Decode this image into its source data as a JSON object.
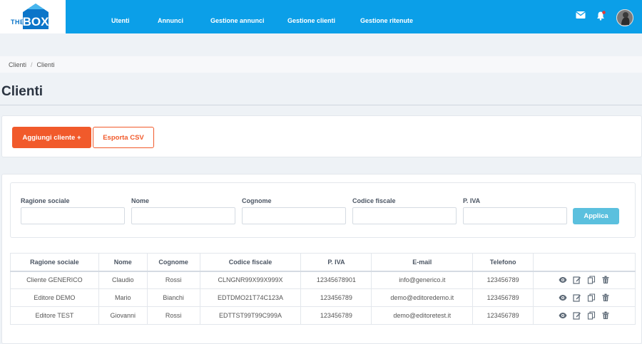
{
  "brand": {
    "the": "THE",
    "box": "BOX"
  },
  "nav": {
    "items": [
      {
        "label": "Utenti"
      },
      {
        "label": "Annunci"
      },
      {
        "label": "Gestione annunci"
      },
      {
        "label": "Gestione clienti"
      },
      {
        "label": "Gestione ritenute"
      }
    ]
  },
  "breadcrumb": [
    "Clienti",
    "Clienti"
  ],
  "page_title": "Clienti",
  "actions": {
    "add_label": "Aggiungi cliente +",
    "export_label": "Esporta CSV"
  },
  "filters": {
    "fields": [
      {
        "label": "Ragione sociale",
        "value": ""
      },
      {
        "label": "Nome",
        "value": ""
      },
      {
        "label": "Cognome",
        "value": ""
      },
      {
        "label": "Codice fiscale",
        "value": ""
      },
      {
        "label": "P. IVA",
        "value": ""
      }
    ],
    "apply_label": "Applica"
  },
  "table": {
    "headers": [
      "Ragione sociale",
      "Nome",
      "Cognome",
      "Codice fiscale",
      "P. IVA",
      "E-mail",
      "Telefono",
      ""
    ],
    "rows": [
      [
        "Cliente GENERICO",
        "Claudio",
        "Rossi",
        "CLNGNR99X99X999X",
        "12345678901",
        "info@generico.it",
        "123456789"
      ],
      [
        "Editore DEMO",
        "Mario",
        "Bianchi",
        "EDTDMO21T74C123A",
        "123456789",
        "demo@editoredemo.it",
        "123456789"
      ],
      [
        "Editore TEST",
        "Giovanni",
        "Rossi",
        "EDTTST99T99C999A",
        "123456789",
        "demo@editoretest.it",
        "123456789"
      ]
    ],
    "row_actions": [
      "eye-icon",
      "edit-icon",
      "copy-icon",
      "trash-icon"
    ]
  },
  "colors": {
    "primary": "#0b9fe8",
    "accent": "#f15a2b",
    "apply": "#5bc0de"
  }
}
